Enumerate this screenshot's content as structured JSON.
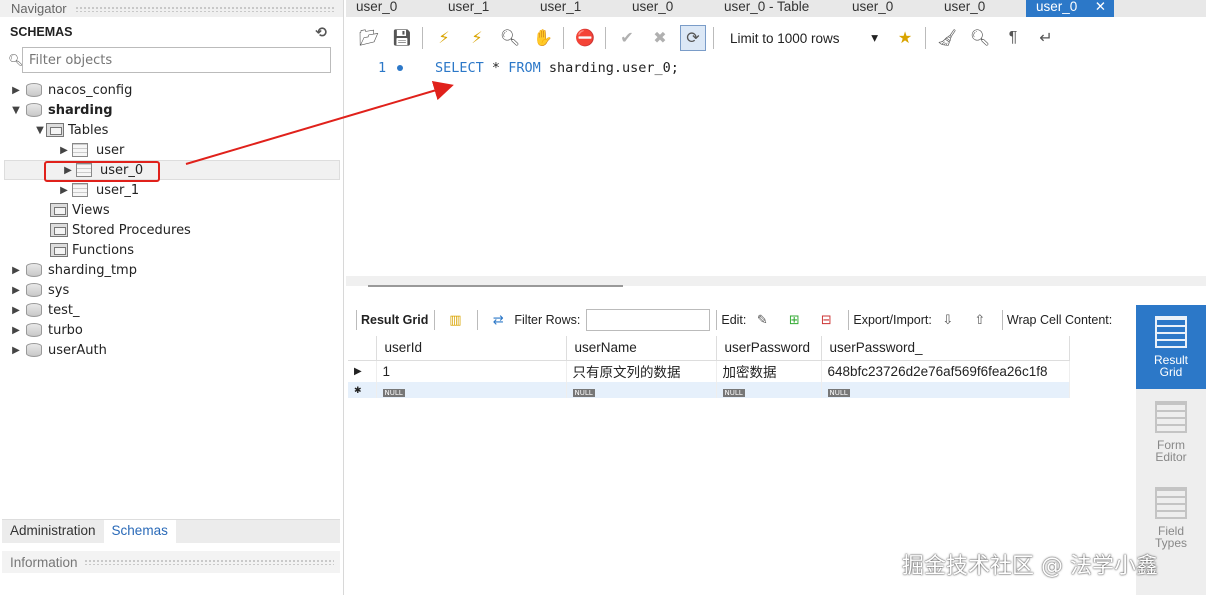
{
  "navigator": {
    "title": "Navigator",
    "schemas_label": "SCHEMAS",
    "filter_placeholder": "Filter objects",
    "tree": {
      "nacos_config": "nacos_config",
      "sharding": "sharding",
      "tables": "Tables",
      "user": "user",
      "user_0": "user_0",
      "user_1": "user_1",
      "views": "Views",
      "stored_procedures": "Stored Procedures",
      "functions": "Functions",
      "sharding_tmp": "sharding_tmp",
      "sys": "sys",
      "test": "test_",
      "turbo": "turbo",
      "userauth": "userAuth"
    },
    "bottom_tabs": [
      "Administration",
      "Schemas"
    ],
    "information": "Information"
  },
  "tabs": [
    "user_0",
    "user_1",
    "user_1",
    "user_0",
    "user_0 - Table",
    "user_0",
    "user_0",
    "user_0"
  ],
  "toolbar": {
    "limit_label": "Limit to 1000 rows"
  },
  "editor": {
    "line_number": "1",
    "keyword_select": "SELECT",
    "star": "*",
    "keyword_from": "FROM",
    "target": "sharding.user_0;"
  },
  "result_toolbar": {
    "result_grid": "Result Grid",
    "filter_rows": "Filter Rows:",
    "edit": "Edit:",
    "export_import": "Export/Import:",
    "wrap": "Wrap Cell Content:"
  },
  "grid": {
    "columns": [
      "userId",
      "userName",
      "userPassword",
      "userPassword_"
    ],
    "rows": [
      [
        "1",
        "只有原文列的数据",
        "加密数据",
        "648bfc23726d2e76af569f6fea26c1f8"
      ]
    ],
    "null_label": "NULL"
  },
  "side_panel": {
    "result_grid": "Result Grid",
    "form_editor": "Form Editor",
    "field_types": "Field Types"
  },
  "watermark": "掘金技术社区 @ 法学小鑫",
  "colors": {
    "accent": "#2c78c8",
    "highlight_red": "#e0211b"
  }
}
